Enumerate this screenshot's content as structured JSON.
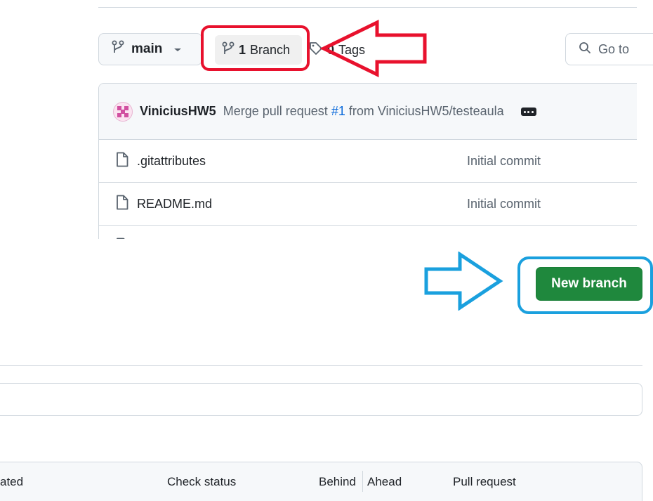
{
  "toolbar": {
    "branch_name": "main",
    "branch_count_num": "1",
    "branch_count_label": "Branch",
    "tags_num": "0",
    "tags_label": "Tags",
    "search_placeholder": "Go to"
  },
  "commit": {
    "author": "ViniciusHW5",
    "message_prefix": "Merge pull request",
    "pr_link": "#1",
    "message_suffix": "from ViniciusHW5/testeaula"
  },
  "files": [
    {
      "name": ".gitattributes",
      "commit": "Initial commit"
    },
    {
      "name": "README.md",
      "commit": "Initial commit"
    }
  ],
  "actions": {
    "new_branch_label": "New branch"
  },
  "branch_table": {
    "headers": {
      "updated": "ated",
      "check_status": "Check status",
      "behind": "Behind",
      "ahead": "Ahead",
      "pull_request": "Pull request"
    }
  },
  "colors": {
    "annotation_red": "#e8112d",
    "annotation_blue": "#1aa0de",
    "primary_green": "#1f883d",
    "link_blue": "#0969da"
  }
}
